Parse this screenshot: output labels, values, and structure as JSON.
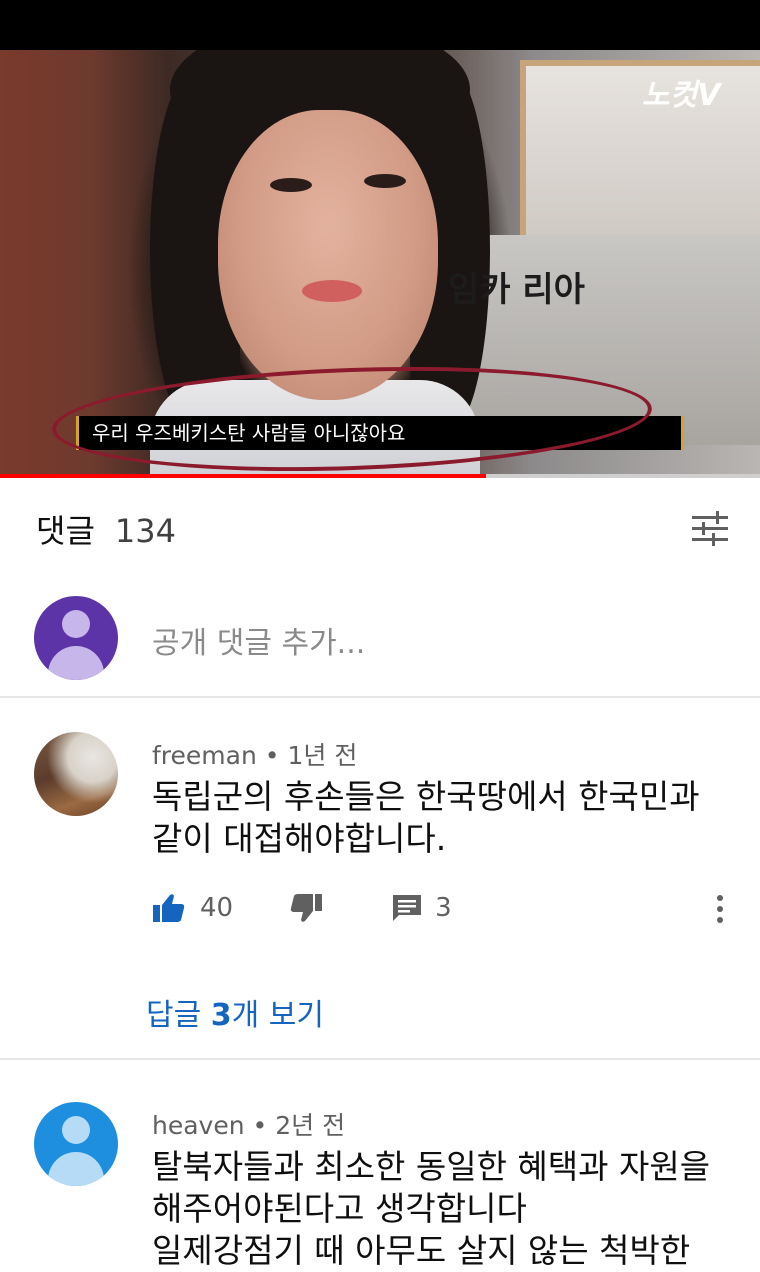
{
  "video": {
    "logo": "노컷V",
    "background_text": "임카   리아",
    "subtitle": "우리 우즈베키스탄 사람들 아니잖아요",
    "progress_fraction": 0.64,
    "annotation_color": "#8b1b2c"
  },
  "comments_header": {
    "title": "댓글",
    "count": "134",
    "filter_icon": "sort-filter-icon"
  },
  "add_comment": {
    "placeholder": "공개 댓글 추가...",
    "avatar_icon": "default-avatar-icon"
  },
  "comments": [
    {
      "author": "freeman",
      "time": "1년 전",
      "text": "독립군의 후손들은 한국땅에서 한국민과\n같이 대접해야합니다.",
      "likes": "40",
      "replies_count": "3",
      "view_replies_prefix": "답글 ",
      "view_replies_count": "3",
      "view_replies_suffix": "개 보기"
    },
    {
      "author": "heaven",
      "time": "2년 전",
      "text": "탈북자들과 최소한 동일한 혜택과 자원을\n해주어야된다고 생각합니다\n일제강점기 때 아무도 살지 않는 척박한"
    }
  ],
  "colors": {
    "accent_blue": "#1565c0",
    "progress_red": "#ff0000",
    "avatar_purple": "#5d34a7",
    "avatar_blue": "#1e8fde"
  }
}
